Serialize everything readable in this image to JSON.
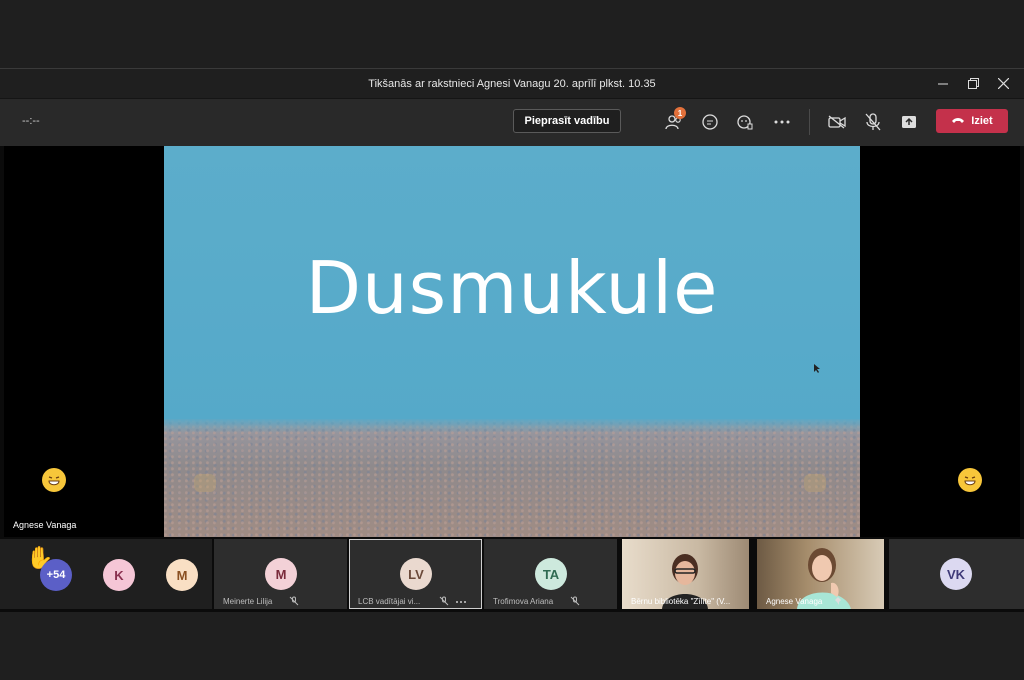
{
  "window": {
    "title": "Tikšanās ar rakstnieci Agnesi Vanagu 20. aprīlī plkst. 10.35",
    "controls": [
      "minimize-icon",
      "restore-icon",
      "close-icon"
    ]
  },
  "toolbar": {
    "timer": "--:--",
    "request_control_label": "Pieprasīt vadību",
    "participants_badge": "1",
    "leave_label": "Iziet",
    "icons": [
      "people-icon",
      "chat-icon",
      "reactions-icon",
      "more-icon",
      "camera-off-icon",
      "mic-off-icon",
      "share-tray-icon",
      "phone-hangup-icon"
    ],
    "leave_color": "#c4314b"
  },
  "stage": {
    "presenter_name": "Agnese Vanaga",
    "shared_title": "Dusmukule",
    "background_color": "#55a9c9"
  },
  "participants": {
    "overflow_count": "+54",
    "tiles": [
      {
        "initials": "K",
        "name": ""
      },
      {
        "initials": "M",
        "name": ""
      },
      {
        "initials": "M",
        "name": "Meinerte Lilija"
      },
      {
        "initials": "LV",
        "name": "LCB vadītājai vi..."
      },
      {
        "initials": "TA",
        "name": "Trofimova Ariana"
      },
      {
        "initials": "",
        "name": "Bērnu bibliotēka \"Zīlīte\" (V..."
      },
      {
        "initials": "",
        "name": "Agnese Vanaga"
      },
      {
        "initials": "VK",
        "name": ""
      }
    ]
  }
}
